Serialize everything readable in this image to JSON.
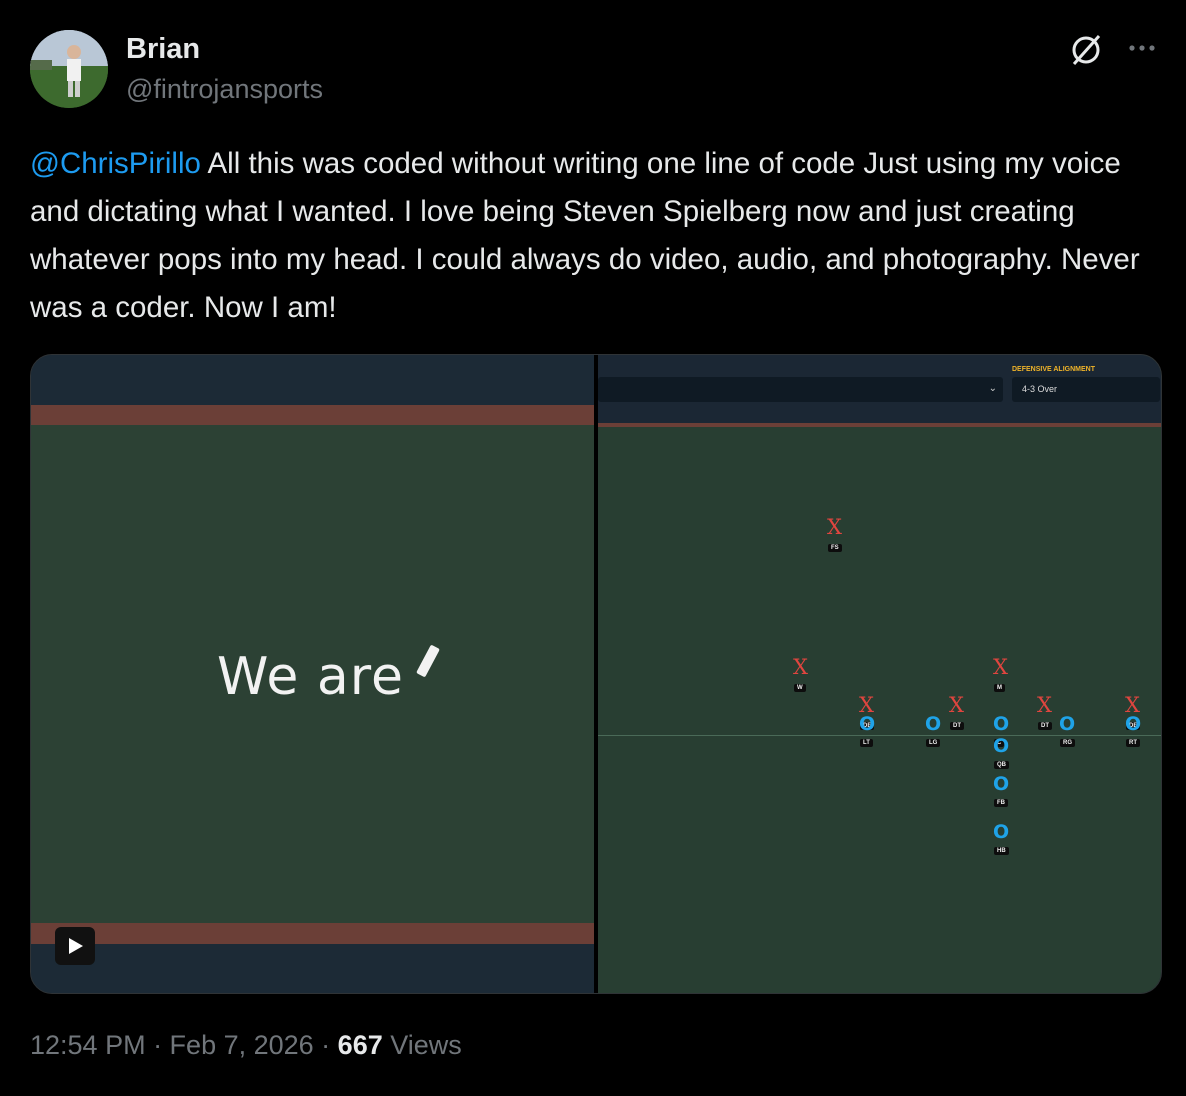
{
  "author": {
    "name": "Brian",
    "handle": "@fintrojansports"
  },
  "tweet": {
    "mention": "@ChrisPirillo",
    "text": " All this was coded without writing one line of code Just using my voice and dictating what I wanted. I love being Steven Spielberg now and just creating whatever pops into my head. I could always do video, audio, and photography. Never was a coder. Now I am!"
  },
  "media": {
    "chalk_text": "We are",
    "defensive_label": "DEFENSIVE ALIGNMENT",
    "alignment_value": "4-3 Over",
    "select_caret": "⌄",
    "defense": [
      {
        "symbol": "X",
        "label": "FS"
      },
      {
        "symbol": "X",
        "label": "W"
      },
      {
        "symbol": "X",
        "label": "M"
      },
      {
        "symbol": "X",
        "label": "DE"
      },
      {
        "symbol": "X",
        "label": "DT"
      },
      {
        "symbol": "X",
        "label": "DT"
      },
      {
        "symbol": "X",
        "label": "DE"
      }
    ],
    "offense": [
      {
        "symbol": "O",
        "label": "LT"
      },
      {
        "symbol": "O",
        "label": "LG"
      },
      {
        "symbol": "O",
        "label": "C"
      },
      {
        "symbol": "O",
        "label": "RG"
      },
      {
        "symbol": "O",
        "label": "RT"
      },
      {
        "symbol": "O",
        "label": "QB"
      },
      {
        "symbol": "O",
        "label": "FB"
      },
      {
        "symbol": "O",
        "label": "HB"
      }
    ]
  },
  "footer": {
    "time": "12:54 PM · Feb 7, 2026 · ",
    "views_count": "667",
    "views_label": " Views"
  },
  "icons": {
    "grok": "grok-icon",
    "more": "more-icon",
    "play": "play-icon"
  }
}
